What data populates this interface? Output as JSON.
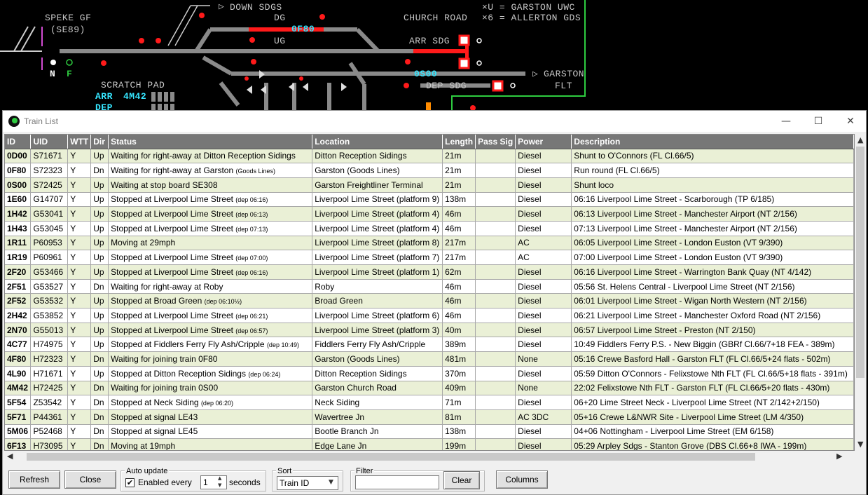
{
  "background": {
    "labels": {
      "speke": "SPEKE GF",
      "speke_code": "(SE89)",
      "down_sdgs": "DOWN SDGS",
      "dg": "DG",
      "ug": "UG",
      "train_0f80": "0F80",
      "church_road": "CHURCH ROAD",
      "key1": "×U = GARSTON UWC",
      "key2": "×6 = ALLERTON GDS",
      "arr_sdg": "ARR SDG",
      "dep_sdg": "DEP SDG",
      "train_0s00": "0S00",
      "garston": "GARSTON",
      "flt": "FLT",
      "scratch_pad": "SCRATCH PAD",
      "arr": "ARR",
      "arr_train": "4M42",
      "dep": "DEP",
      "n": "N",
      "f": "F",
      "down_arrow": "▷",
      "garston_arrow": "▷"
    }
  },
  "window": {
    "title": "Train List",
    "minimize": "—",
    "maximize": "☐",
    "close": "✕"
  },
  "table": {
    "columns": [
      "ID",
      "UID",
      "WTT",
      "Dir",
      "Status",
      "Location",
      "Length",
      "Pass Sig",
      "Power",
      "Description"
    ],
    "rows": [
      {
        "id": "0D00",
        "uid": "S71671",
        "wtt": "Y",
        "dir": "Up",
        "status": "Waiting for right-away at Ditton Reception Sidings",
        "status_small": "",
        "location": "Ditton Reception Sidings",
        "length": "21m",
        "pass_sig": "",
        "power": "Diesel",
        "description": "Shunt to O'Connors (FL Cl.66/5)"
      },
      {
        "id": "0F80",
        "uid": "S72323",
        "wtt": "Y",
        "dir": "Dn",
        "status": "Waiting for right-away at Garston",
        "status_small": "(Goods Lines)",
        "location": "Garston (Goods Lines)",
        "length": "21m",
        "pass_sig": "",
        "power": "Diesel",
        "description": "Run round (FL Cl.66/5)"
      },
      {
        "id": "0S00",
        "uid": "S72425",
        "wtt": "Y",
        "dir": "Up",
        "status": "Waiting at stop board SE308",
        "status_small": "",
        "location": "Garston Freightliner Terminal",
        "length": "21m",
        "pass_sig": "",
        "power": "Diesel",
        "description": "Shunt loco"
      },
      {
        "id": "1E60",
        "uid": "G14707",
        "wtt": "Y",
        "dir": "Up",
        "status": "Stopped at Liverpool Lime Street",
        "status_small": "(dep 06:16)",
        "location": "Liverpool Lime Street (platform 9)",
        "length": "138m",
        "pass_sig": "",
        "power": "Diesel",
        "description": "06:16 Liverpool Lime Street - Scarborough (TP 6/185)"
      },
      {
        "id": "1H42",
        "uid": "G53041",
        "wtt": "Y",
        "dir": "Up",
        "status": "Stopped at Liverpool Lime Street",
        "status_small": "(dep 06:13)",
        "location": "Liverpool Lime Street (platform 4)",
        "length": "46m",
        "pass_sig": "",
        "power": "Diesel",
        "description": "06:13 Liverpool Lime Street - Manchester Airport (NT 2/156)"
      },
      {
        "id": "1H43",
        "uid": "G53045",
        "wtt": "Y",
        "dir": "Up",
        "status": "Stopped at Liverpool Lime Street",
        "status_small": "(dep 07:13)",
        "location": "Liverpool Lime Street (platform 4)",
        "length": "46m",
        "pass_sig": "",
        "power": "Diesel",
        "description": "07:13 Liverpool Lime Street - Manchester Airport (NT 2/156)"
      },
      {
        "id": "1R11",
        "uid": "P60953",
        "wtt": "Y",
        "dir": "Up",
        "status": "Moving at 29mph",
        "status_small": "",
        "location": "Liverpool Lime Street (platform 8)",
        "length": "217m",
        "pass_sig": "",
        "power": "AC",
        "description": "06:05 Liverpool Lime Street - London Euston (VT 9/390)"
      },
      {
        "id": "1R19",
        "uid": "P60961",
        "wtt": "Y",
        "dir": "Up",
        "status": "Stopped at Liverpool Lime Street",
        "status_small": "(dep 07:00)",
        "location": "Liverpool Lime Street (platform 7)",
        "length": "217m",
        "pass_sig": "",
        "power": "AC",
        "description": "07:00 Liverpool Lime Street - London Euston (VT 9/390)"
      },
      {
        "id": "2F20",
        "uid": "G53466",
        "wtt": "Y",
        "dir": "Up",
        "status": "Stopped at Liverpool Lime Street",
        "status_small": "(dep 06:16)",
        "location": "Liverpool Lime Street (platform 1)",
        "length": "62m",
        "pass_sig": "",
        "power": "Diesel",
        "description": "06:16 Liverpool Lime Street - Warrington Bank Quay (NT 4/142)"
      },
      {
        "id": "2F51",
        "uid": "G53527",
        "wtt": "Y",
        "dir": "Dn",
        "status": "Waiting for right-away at Roby",
        "status_small": "",
        "location": "Roby",
        "length": "46m",
        "pass_sig": "",
        "power": "Diesel",
        "description": "05:56 St. Helens Central - Liverpool Lime Street (NT 2/156)"
      },
      {
        "id": "2F52",
        "uid": "G53532",
        "wtt": "Y",
        "dir": "Up",
        "status": "Stopped at Broad Green",
        "status_small": "(dep 06:10½)",
        "location": "Broad Green",
        "length": "46m",
        "pass_sig": "",
        "power": "Diesel",
        "description": "06:01 Liverpool Lime Street - Wigan North Western (NT 2/156)"
      },
      {
        "id": "2H42",
        "uid": "G53852",
        "wtt": "Y",
        "dir": "Up",
        "status": "Stopped at Liverpool Lime Street",
        "status_small": "(dep 06:21)",
        "location": "Liverpool Lime Street (platform 6)",
        "length": "46m",
        "pass_sig": "",
        "power": "Diesel",
        "description": "06:21 Liverpool Lime Street - Manchester Oxford Road (NT 2/156)"
      },
      {
        "id": "2N70",
        "uid": "G55013",
        "wtt": "Y",
        "dir": "Up",
        "status": "Stopped at Liverpool Lime Street",
        "status_small": "(dep 06:57)",
        "location": "Liverpool Lime Street (platform 3)",
        "length": "40m",
        "pass_sig": "",
        "power": "Diesel",
        "description": "06:57 Liverpool Lime Street - Preston (NT 2/150)"
      },
      {
        "id": "4C77",
        "uid": "H74975",
        "wtt": "Y",
        "dir": "Up",
        "status": "Stopped at Fiddlers Ferry Fly Ash/Cripple",
        "status_small": "(dep 10:49)",
        "location": "Fiddlers Ferry Fly Ash/Cripple",
        "length": "389m",
        "pass_sig": "",
        "power": "Diesel",
        "description": "10:49 Fiddlers Ferry P.S. - New Biggin (GBRf Cl.66/7+18 FEA - 389m)"
      },
      {
        "id": "4F80",
        "uid": "H72323",
        "wtt": "Y",
        "dir": "Dn",
        "status": "Waiting for joining train 0F80",
        "status_small": "",
        "location": "Garston (Goods Lines)",
        "length": "481m",
        "pass_sig": "",
        "power": "None",
        "description": "05:16 Crewe Basford Hall - Garston FLT (FL Cl.66/5+24 flats - 502m)"
      },
      {
        "id": "4L90",
        "uid": "H71671",
        "wtt": "Y",
        "dir": "Up",
        "status": "Stopped at Ditton Reception Sidings",
        "status_small": "(dep 06:24)",
        "location": "Ditton Reception Sidings",
        "length": "370m",
        "pass_sig": "",
        "power": "Diesel",
        "description": "05:59 Ditton O'Connors - Felixstowe Nth FLT (FL Cl.66/5+18 flats - 391m)"
      },
      {
        "id": "4M42",
        "uid": "H72425",
        "wtt": "Y",
        "dir": "Dn",
        "status": "Waiting for joining train 0S00",
        "status_small": "",
        "location": "Garston Church Road",
        "length": "409m",
        "pass_sig": "",
        "power": "None",
        "description": "22:02 Felixstowe Nth FLT - Garston FLT (FL Cl.66/5+20 flats - 430m)"
      },
      {
        "id": "5F54",
        "uid": "Z53542",
        "wtt": "Y",
        "dir": "Dn",
        "status": "Stopped at Neck Siding",
        "status_small": "(dep 06:20)",
        "location": "Neck Siding",
        "length": "71m",
        "pass_sig": "",
        "power": "Diesel",
        "description": "06+20 Lime Street Neck - Liverpool Lime Street (NT 2/142+2/150)"
      },
      {
        "id": "5F71",
        "uid": "P44361",
        "wtt": "Y",
        "dir": "Dn",
        "status": "Stopped at signal LE43",
        "status_small": "",
        "location": "Wavertree Jn",
        "length": "81m",
        "pass_sig": "",
        "power": "AC 3DC",
        "description": "05+16 Crewe L&NWR Site - Liverpool Lime Street (LM 4/350)"
      },
      {
        "id": "5M06",
        "uid": "P52468",
        "wtt": "Y",
        "dir": "Dn",
        "status": "Stopped at signal LE45",
        "status_small": "",
        "location": "Bootle Branch Jn",
        "length": "138m",
        "pass_sig": "",
        "power": "Diesel",
        "description": "04+06 Nottingham - Liverpool Lime Street (EM 6/158)"
      },
      {
        "id": "6F13",
        "uid": "H73095",
        "wtt": "Y",
        "dir": "Dn",
        "status": "Moving at 19mph",
        "status_small": "",
        "location": "Edge Lane Jn",
        "length": "199m",
        "pass_sig": "",
        "power": "Diesel",
        "description": "05:29 Arpley Sdgs - Stanton Grove (DBS Cl.66+8 IWA - 199m)"
      }
    ]
  },
  "controls": {
    "refresh": "Refresh",
    "close": "Close",
    "auto_update": {
      "label": "Auto update",
      "enabled_label": "Enabled every",
      "checked": "✔",
      "value": "1",
      "unit": "seconds"
    },
    "sort": {
      "label": "Sort",
      "value": "Train ID"
    },
    "filter": {
      "label": "Filter",
      "value": "",
      "clear": "Clear"
    },
    "columns": "Columns"
  },
  "colors": {
    "track": "#8a8a8a",
    "set_route": "#ff1a1a",
    "cyan": "#36e6ff",
    "row_alt": "#eaf0d6",
    "header": "#777777"
  }
}
